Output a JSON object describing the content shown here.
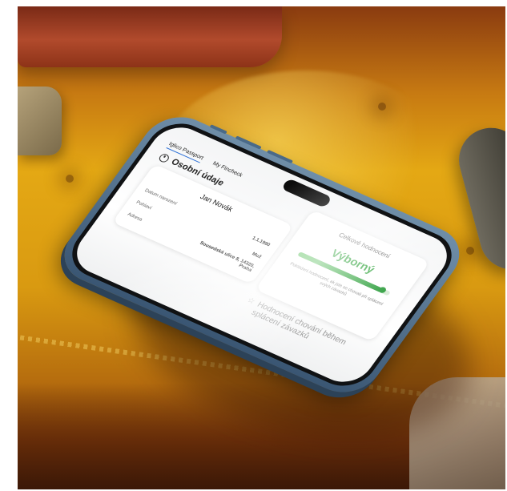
{
  "app": {
    "tabs": [
      {
        "label": "Iglico Passport",
        "active": true
      },
      {
        "label": "My Fincheck",
        "active": false
      }
    ],
    "section_title": "Osobní údaje",
    "section_icon": "person-icon"
  },
  "personal_card": {
    "name": "Jan Novák",
    "rows": [
      {
        "label": "Datum narození",
        "value": "1.1.1990"
      },
      {
        "label": "Pohlaví",
        "value": "Muž"
      },
      {
        "label": "Adresa",
        "value": "Sousedská ulice 8, 14320, Praha"
      }
    ]
  },
  "rating_card": {
    "title": "Celkové hodnocení",
    "value": "Výborný",
    "progress_fraction": 0.92,
    "description": "Pokládeni hodnocení, ak jste se chovali při splácení svých závazků"
  },
  "footer": {
    "heading": "Hodnocení chování během splácení závazků",
    "icon": "star-icon"
  },
  "colors": {
    "accent": "#2c6fd6",
    "rating_green": "#3aa845",
    "phone_frame": "#4f6f8e",
    "sofa_yellow": "#e4a814"
  }
}
